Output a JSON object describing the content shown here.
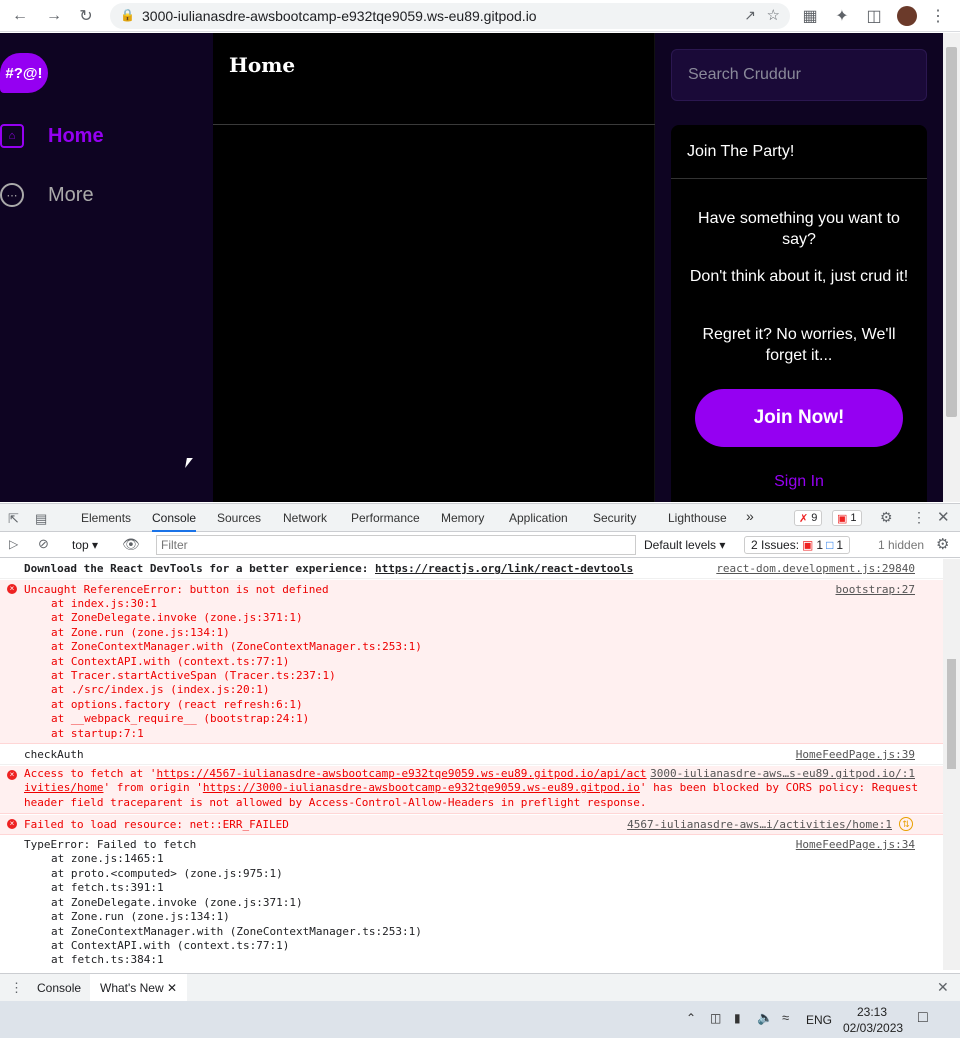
{
  "browser": {
    "url": "3000-iulianasdre-awsbootcamp-e932tqe9059.ws-eu89.gitpod.io"
  },
  "app": {
    "logo_text": "#?@!",
    "nav": [
      {
        "label": "Home",
        "icon": "home-icon",
        "active": true
      },
      {
        "label": "More",
        "icon": "more-icon",
        "active": false
      }
    ],
    "feed_title": "Home",
    "search_placeholder": "Search Cruddur",
    "join_box": {
      "title": "Join The Party!",
      "p1": "Have something you want to say?",
      "p2": "Don't think about it, just crud it!",
      "p3": "Regret it? No worries, We'll forget it...",
      "join_button": "Join Now!",
      "sign_in": "Sign In"
    },
    "accent_color": "#9500f2",
    "sidebar_color": "#0e0422"
  },
  "devtools": {
    "tabs": [
      "Elements",
      "Console",
      "Sources",
      "Network",
      "Performance",
      "Memory",
      "Application",
      "Security",
      "Lighthouse"
    ],
    "more_tabs": "»",
    "error_count": "9",
    "issue_count": "1",
    "context": "top",
    "filter_placeholder": "Filter",
    "levels": "Default levels",
    "issues": "2 Issues:",
    "issues_err": "1",
    "issues_info": "1",
    "hidden": "1 hidden",
    "messages": {
      "m1_text": "Download the React DevTools for a better experience: ",
      "m1_link": "https://reactjs.org/link/react-devtools",
      "m1_src": "react-dom.development.js:29840",
      "m2_title": "Uncaught ReferenceError: button is not defined",
      "m2_src": "bootstrap:27",
      "m2_stack": [
        "at index.js:30:1",
        "at ZoneDelegate.invoke (zone.js:371:1)",
        "at Zone.run (zone.js:134:1)",
        "at ZoneContextManager.with (ZoneContextManager.ts:253:1)",
        "at ContextAPI.with (context.ts:77:1)",
        "at Tracer.startActiveSpan (Tracer.ts:237:1)",
        "at ./src/index.js (index.js:20:1)",
        "at options.factory (react refresh:6:1)",
        "at __webpack_require__ (bootstrap:24:1)",
        "at startup:7:1"
      ],
      "m3_text": "checkAuth",
      "m3_src": "HomeFeedPage.js:39",
      "m4_l1a": "Access to fetch at '",
      "m4_l1b": "https://4567-iulianasdre-awsbootcamp-e932tqe9059.ws-eu89.gitpod.io/api/act",
      "m4_src": "3000-iulianasdre-aws…s-eu89.gitpod.io/:1",
      "m4_l2a": "ivities/home",
      "m4_l2b": "' from origin '",
      "m4_l2c": "https://3000-iulianasdre-awsbootcamp-e932tqe9059.ws-eu89.gitpod.io",
      "m4_l2d": "' has been blocked by CORS policy: Request",
      "m4_l3": "header field traceparent is not allowed by Access-Control-Allow-Headers in preflight response.",
      "m5_text": "Failed to load resource: net::ERR_FAILED",
      "m5_src": "4567-iulianasdre-aws…i/activities/home:1",
      "m6_title": "TypeError: Failed to fetch",
      "m6_src": "HomeFeedPage.js:34",
      "m6_stack": [
        "at zone.js:1465:1",
        "at proto.<computed> (zone.js:975:1)",
        "at fetch.ts:391:1",
        "at ZoneDelegate.invoke (zone.js:371:1)",
        "at Zone.run (zone.js:134:1)",
        "at ZoneContextManager.with (ZoneContextManager.ts:253:1)",
        "at ContextAPI.with (context.ts:77:1)",
        "at fetch.ts:384:1"
      ]
    },
    "drawer_tabs": [
      "Console",
      "What's New"
    ]
  },
  "taskbar": {
    "lang": "ENG",
    "time": "23:13",
    "date": "02/03/2023"
  }
}
